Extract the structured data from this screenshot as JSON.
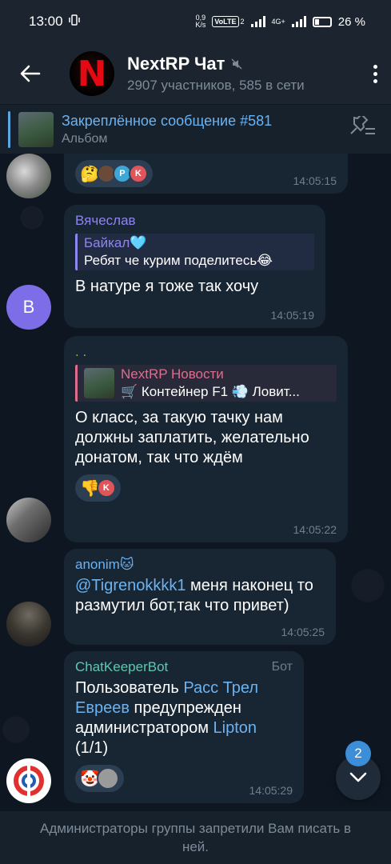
{
  "status_bar": {
    "time": "13:00",
    "net_speed_value": "0,9",
    "net_speed_unit": "K/s",
    "volte": "VoLTE",
    "volte_sub": "2",
    "signal_label": "4G+",
    "battery": "26 %"
  },
  "header": {
    "title": "NextRP Чат",
    "subtitle": "2907 участников, 585 в сети",
    "avatar_letter": "N"
  },
  "pinned": {
    "title": "Закреплённое сообщение #581",
    "subtitle": "Альбом"
  },
  "messages": [
    {
      "time": "14:05:15",
      "reactions": [
        {
          "emoji": "🤔",
          "avatars": [
            "",
            "P",
            "K"
          ]
        }
      ]
    },
    {
      "sender": "Вячеслав",
      "sender_color": "#8e85ee",
      "avatar_letter": "B",
      "reply_title": "Байкал🩵",
      "reply_text": "Ребят че курим поделитесь😂",
      "text": "В натуре я тоже так хочу",
      "time": "14:05:19"
    },
    {
      "sender": ". .",
      "sender_color": "#7fbe5a",
      "reply_title": "NextRP Новости",
      "reply_text": "🛒 Контейнер F1 💨 Ловит...",
      "text": "О класс, за такую тачку нам должны заплатить, желательно донатом, так что ждём",
      "time": "14:05:22",
      "reactions": [
        {
          "emoji": "👎",
          "avatars": [
            "K"
          ]
        }
      ]
    },
    {
      "sender": "anonim🐱",
      "sender_color": "#6ab3f3",
      "mention": "@Tigrenokkkk1",
      "text": " меня наконец то размутил бот,так что привет)",
      "time": "14:05:25"
    },
    {
      "sender": "ChatKeeperBot",
      "sender_color": "#5fc8b0",
      "bot_label": "Бот",
      "text_prefix": "Пользователь ",
      "user_link": "Расс Трел Евреев",
      "text_middle": " предупрежден администратором ",
      "admin_link": "Lipton",
      "text_suffix": " (1/1)",
      "time": "14:05:29",
      "reactions": [
        {
          "emoji": "🤡",
          "avatars": [
            ""
          ]
        }
      ]
    }
  ],
  "scroll_badge": "2",
  "footer_text": "Администраторы группы запретили Вам писать в ней.",
  "colors": {
    "accent": "#6ab3f3",
    "bubble": "#182533",
    "background": "#0e1621",
    "header": "#1c242f"
  }
}
